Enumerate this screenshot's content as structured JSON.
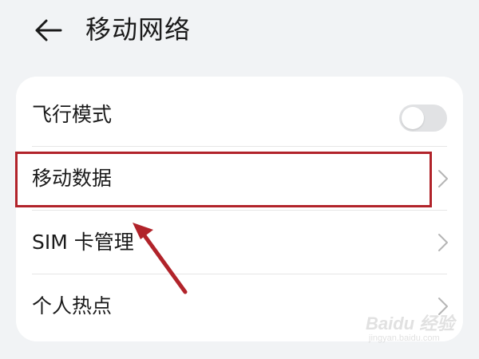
{
  "header": {
    "back_icon": "arrow-left-icon",
    "title": "移动网络"
  },
  "settings": {
    "items": [
      {
        "label": "飞行模式",
        "control": "toggle",
        "toggle_on": false
      },
      {
        "label": "移动数据",
        "control": "chevron",
        "highlighted": true
      },
      {
        "label": "SIM 卡管理",
        "control": "chevron"
      },
      {
        "label": "个人热点",
        "control": "chevron"
      }
    ]
  },
  "annotation": {
    "highlight_color": "#b1232a",
    "arrow_color": "#b1232a"
  },
  "watermark": {
    "brand": "Baidu 经验",
    "url": "jingyan.baidu.com"
  },
  "colors": {
    "background": "#f1f3f5",
    "card": "#ffffff",
    "text": "#1a1a1a",
    "toggle_off": "#e1e2e4",
    "chevron": "#b5b5b5"
  }
}
